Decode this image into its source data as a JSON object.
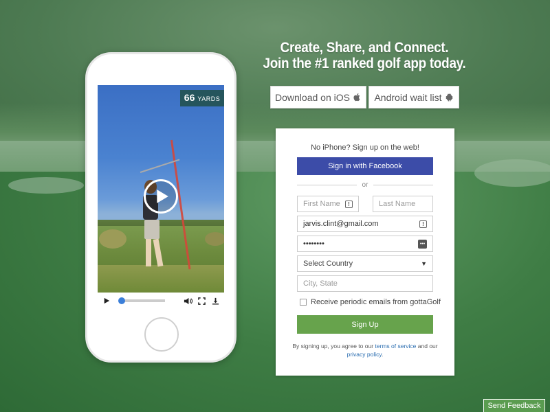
{
  "headline": {
    "line1": "Create, Share, and Connect.",
    "line2": "Join the #1 ranked golf app today."
  },
  "store": {
    "ios_label": "Download on iOS",
    "ios_icon": "apple-icon",
    "android_label": "Android wait list",
    "android_icon": "android-icon"
  },
  "video": {
    "yards_number": "66",
    "yards_unit": "YARDS",
    "progress_fraction": 0.05,
    "icons": [
      "play-icon",
      "volume-icon",
      "fullscreen-icon",
      "download-icon"
    ]
  },
  "signup": {
    "title": "No iPhone? Sign up on the web!",
    "facebook_label": "Sign in with Facebook",
    "or_label": "or",
    "first_name_placeholder": "First Name",
    "last_name_placeholder": "Last Name",
    "email_value": "jarvis.clint@gmail.com",
    "password_value": "••••••••",
    "country_selected": "Select Country",
    "city_placeholder": "City, State",
    "emails_checkbox_label": "Receive periodic emails from gottaGolf",
    "emails_checked": false,
    "signup_label": "Sign Up",
    "terms_prefix": "By signing up, you agree to our",
    "terms_link": "terms of service",
    "terms_middle": "and our",
    "privacy_link": "privacy policy",
    "terms_suffix": "."
  },
  "feedback_label": "Send Feedback",
  "colors": {
    "facebook": "#3c4ca8",
    "signup": "#67a34c",
    "yards_badge": "#25555c",
    "link": "#2a6db0"
  }
}
